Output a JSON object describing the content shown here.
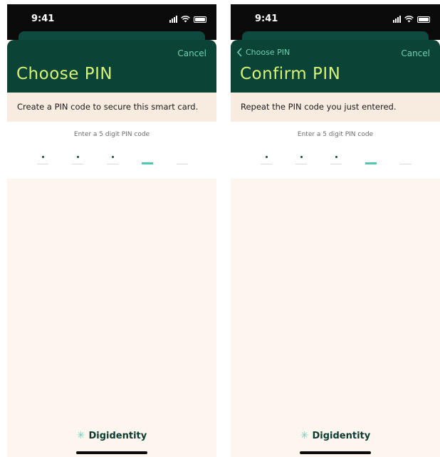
{
  "screens": [
    {
      "time": "9:41",
      "back": "",
      "cancel": "Cancel",
      "title": "Choose PIN",
      "description": "Create a PIN code to secure this smart card.",
      "hint": "Enter a 5 digit PIN code",
      "brand": "Digidentity"
    },
    {
      "time": "9:41",
      "back": "Choose PIN",
      "cancel": "Cancel",
      "title": "Confirm PIN",
      "description": "Repeat the PIN code you just entered.",
      "hint": "Enter a 5 digit PIN code",
      "brand": "Digidentity"
    }
  ],
  "pin": {
    "digits_total": 5,
    "digits_entered": 3,
    "active_index": 3
  },
  "colors": {
    "header": "#0b4337",
    "title": "#d6f277",
    "accent": "#53c6b0",
    "background": "#fdf6ef"
  },
  "icons": {
    "brand": "sparkle-icon",
    "back": "chevron-left-icon"
  }
}
